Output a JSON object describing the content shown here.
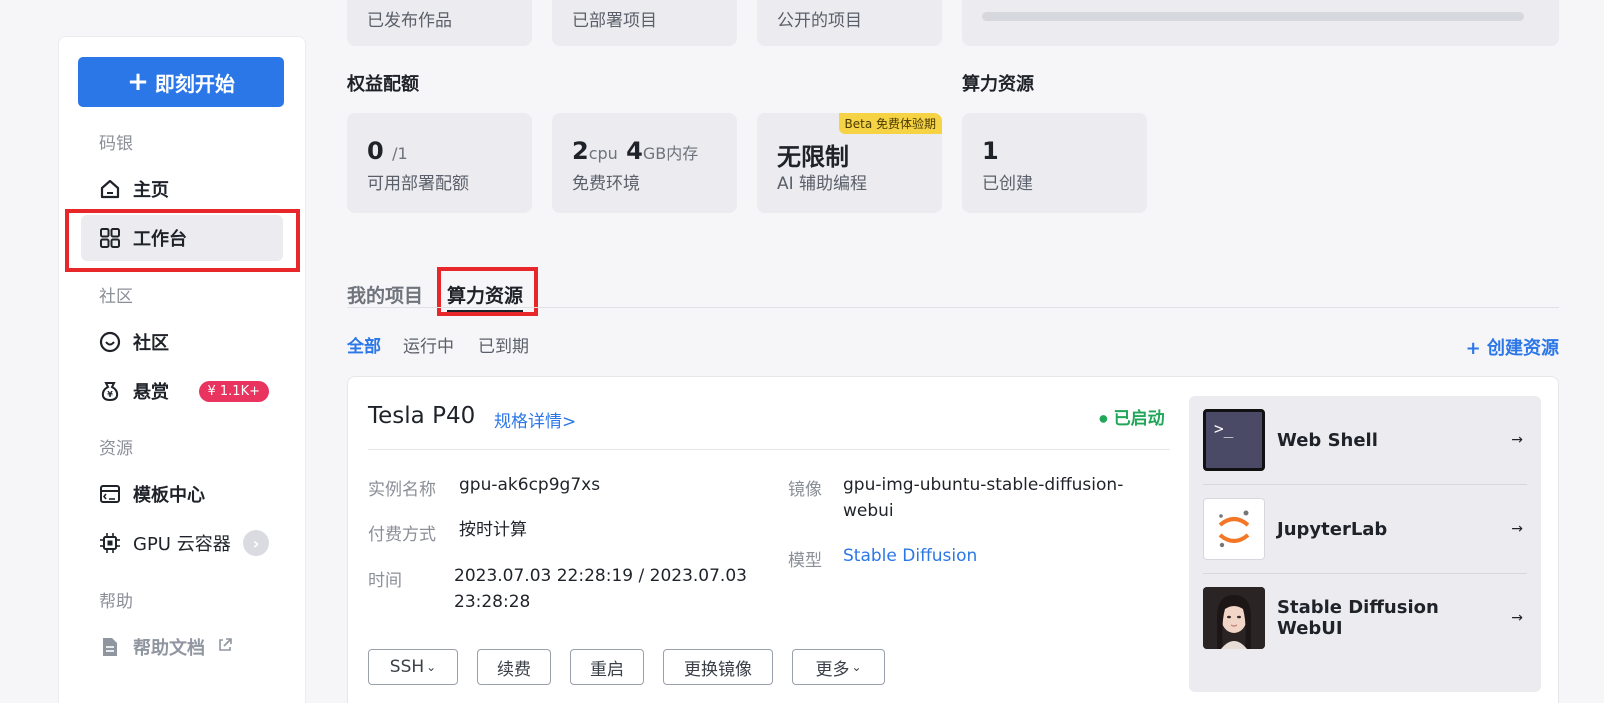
{
  "top_stats": {
    "published": "已发布作品",
    "deployed": "已部署项目",
    "public_projects": "公开的项目"
  },
  "quota_section": {
    "title": "权益配额",
    "cards": [
      {
        "value": "0",
        "suffix": "/1",
        "label": "可用部署配额"
      },
      {
        "value_cpu": "2",
        "unit_cpu": "cpu",
        "value_mem": "4",
        "unit_mem": "GB内存",
        "label": "免费环境"
      },
      {
        "value": "无限制",
        "label": "AI 辅助编程",
        "tag": "Beta 免费体验期"
      }
    ]
  },
  "compute_section": {
    "title": "算力资源",
    "card": {
      "value": "1",
      "label": "已创建"
    }
  },
  "sidebar": {
    "start_button": "即刻开始",
    "groups": [
      {
        "label": "码银"
      },
      {
        "label": "社区"
      },
      {
        "label": "资源"
      },
      {
        "label": "帮助"
      }
    ],
    "items": {
      "home": "主页",
      "workbench": "工作台",
      "community": "社区",
      "bounty": "悬赏",
      "bounty_badge": "¥ 1.1K+",
      "templates": "模板中心",
      "gpu": "GPU 云容器",
      "help_docs": "帮助文档"
    }
  },
  "tabs": {
    "my_projects": "我的项目",
    "compute": "算力资源"
  },
  "filters": {
    "all": "全部",
    "running": "运行中",
    "expired": "已到期"
  },
  "create_resource": "创建资源",
  "resource": {
    "title": "Tesla P40",
    "spec_link": "规格详情>",
    "status": "已启动",
    "instance_key": "实例名称",
    "instance_val": "gpu-ak6cp9g7xs",
    "billing_key": "付费方式",
    "billing_val": "按时计算",
    "time_key": "时间",
    "time_val": "2023.07.03 22:28:19 / 2023.07.03 23:28:28",
    "image_key": "镜像",
    "image_val": "gpu-img-ubuntu-stable-diffusion-webui",
    "model_key": "模型",
    "model_val": "Stable Diffusion",
    "buttons": {
      "ssh": "SSH",
      "renew": "续费",
      "restart": "重启",
      "change_image": "更换镜像",
      "more": "更多"
    },
    "tools": [
      {
        "name": "Web Shell",
        "icon": "terminal-icon"
      },
      {
        "name": "JupyterLab",
        "icon": "jupyter-icon"
      },
      {
        "name": "Stable Diffusion WebUI",
        "icon": "portrait-icon"
      }
    ]
  },
  "colors": {
    "accent": "#2b77e8",
    "status_green": "#21a65a",
    "highlight_red": "#e8272b",
    "badge_pink": "#e8345e",
    "beta_yellow": "#f6d344"
  }
}
